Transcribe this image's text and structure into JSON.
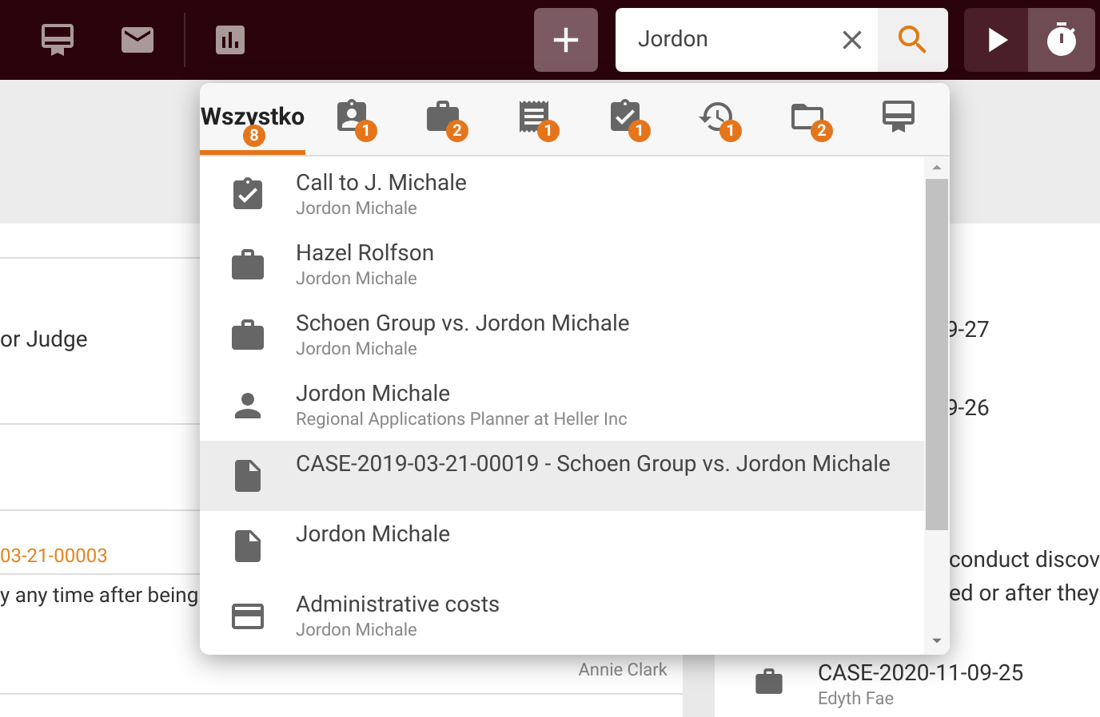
{
  "search": {
    "value": "Jordon"
  },
  "tabs": [
    {
      "label": "Wszystko",
      "count": "8",
      "selected": true
    },
    {
      "count": "1",
      "selected": false
    },
    {
      "count": "2",
      "selected": false
    },
    {
      "count": "1",
      "selected": false
    },
    {
      "count": "1",
      "selected": false
    },
    {
      "count": "1",
      "selected": false
    },
    {
      "count": "2",
      "selected": false
    },
    {
      "selected": false
    }
  ],
  "results": [
    {
      "kind": "task",
      "title": "Call to J. Michale",
      "subtitle": "Jordon Michale",
      "highlighted": false
    },
    {
      "kind": "case",
      "title": "Hazel Rolfson",
      "subtitle": "Jordon Michale",
      "highlighted": false
    },
    {
      "kind": "case",
      "title": "Schoen Group vs. Jordon Michale",
      "subtitle": "Jordon Michale",
      "highlighted": false
    },
    {
      "kind": "contact",
      "title": "Jordon Michale",
      "subtitle": "Regional Applications Planner at Heller Inc",
      "highlighted": false
    },
    {
      "kind": "document",
      "title": "CASE-2019-03-21-00019 - Schoen Group vs. Jordon Michale",
      "highlighted": true
    },
    {
      "kind": "document",
      "title": "Jordon Michale",
      "highlighted": false
    },
    {
      "kind": "expense",
      "title": "Administrative costs",
      "subtitle": "Jordon Michale",
      "highlighted": false
    }
  ],
  "left_panel": {
    "line_1": "or Judge",
    "case_number": "03-21-00003",
    "line_2": "y any time after being",
    "author": "Annie Clark"
  },
  "right_panel": {
    "date_1": "9-27",
    "date_2": "9-26",
    "text_1": "conduct discov",
    "text_2": "ed or after they",
    "case": {
      "title": "CASE-2020-11-09-25",
      "subtitle": "Edyth Fae"
    }
  }
}
